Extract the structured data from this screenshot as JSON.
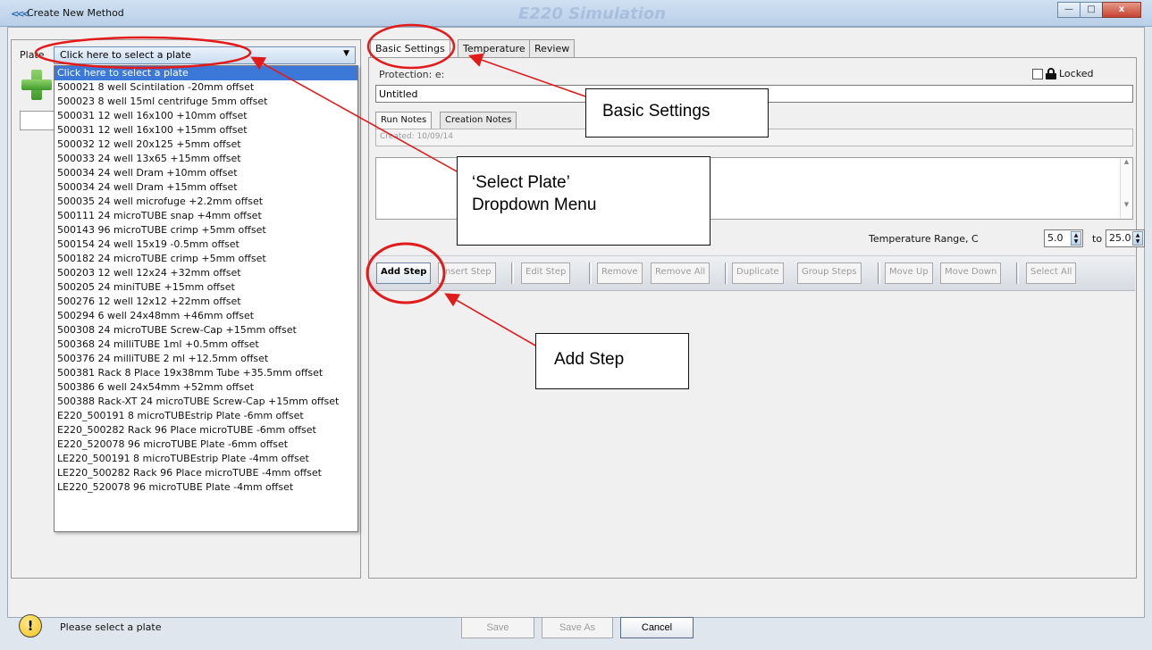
{
  "window": {
    "title": "Create New Method",
    "background_title": "E220 Simulation",
    "buttons": {
      "minimize": "—",
      "maximize": "□",
      "close": "x"
    }
  },
  "plate": {
    "label": "Plate",
    "selected": "Click here to select a plate",
    "options": [
      "Click here to select a plate",
      "500021 8 well Scintilation -20mm offset",
      "500023 8 well 15ml centrifuge 5mm offset",
      "500031 12 well 16x100 +10mm offset",
      "500031 12 well 16x100 +15mm offset",
      "500032 12 well 20x125 +5mm offset",
      "500033 24 well 13x65 +15mm offset",
      "500034 24 well Dram +10mm offset",
      "500034 24 well Dram +15mm offset",
      "500035 24 well microfuge +2.2mm offset",
      "500111 24 microTUBE snap +4mm offset",
      "500143 96 microTUBE crimp +5mm offset",
      "500154 24 well 15x19 -0.5mm offset",
      "500182 24 microTUBE crimp +5mm offset",
      "500203 12 well 12x24 +32mm offset",
      "500205 24 miniTUBE +15mm offset",
      "500276 12 well 12x12 +22mm offset",
      "500294 6 well 24x48mm +46mm offset",
      "500308 24 microTUBE Screw-Cap +15mm offset",
      "500368 24 milliTUBE 1ml +0.5mm offset",
      "500376 24 milliTUBE 2 ml +12.5mm offset",
      "500381 Rack 8 Place 19x38mm Tube  +35.5mm offset",
      "500386 6 well 24x54mm +52mm offset",
      "500388 Rack-XT 24 microTUBE Screw-Cap +15mm offset",
      "E220_500191 8 microTUBEstrip Plate -6mm offset",
      "E220_500282 Rack 96 Place microTUBE -6mm offset",
      "E220_520078 96 microTUBE Plate -6mm offset",
      "LE220_500191 8 microTUBEstrip Plate -4mm offset",
      "LE220_500282 Rack 96 Place microTUBE -4mm offset",
      "LE220_520078 96 microTUBE Plate -4mm offset"
    ]
  },
  "tabs": [
    "Basic Settings",
    "Temperature",
    "Review"
  ],
  "basic": {
    "protection_label": "Protection:  e:",
    "locked_label": "Locked",
    "name_value": "Untitled",
    "notes_tabs": [
      "Run Notes",
      "Creation Notes"
    ],
    "created": "Created: 10/09/14",
    "temp_label": "Temperature Range, C",
    "temp_min": "5.0",
    "temp_to": "to",
    "temp_max": "25.0"
  },
  "toolbar": [
    "Add Step",
    "Insert Step",
    "Edit Step",
    "Remove",
    "Remove All",
    "Duplicate",
    "Group Steps",
    "Move Up",
    "Move Down",
    "Select All"
  ],
  "status": {
    "text": "Please select a plate"
  },
  "bottom_buttons": {
    "save": "Save",
    "save_as": "Save As",
    "cancel": "Cancel"
  },
  "annotations": {
    "basic_settings": "Basic Settings",
    "select_plate_line1": "‘Select Plate’",
    "select_plate_line2": "Dropdown Menu",
    "add_step": "Add Step"
  },
  "colors": {
    "annotation": "#e21a1a",
    "selection": "#3c78d8"
  }
}
